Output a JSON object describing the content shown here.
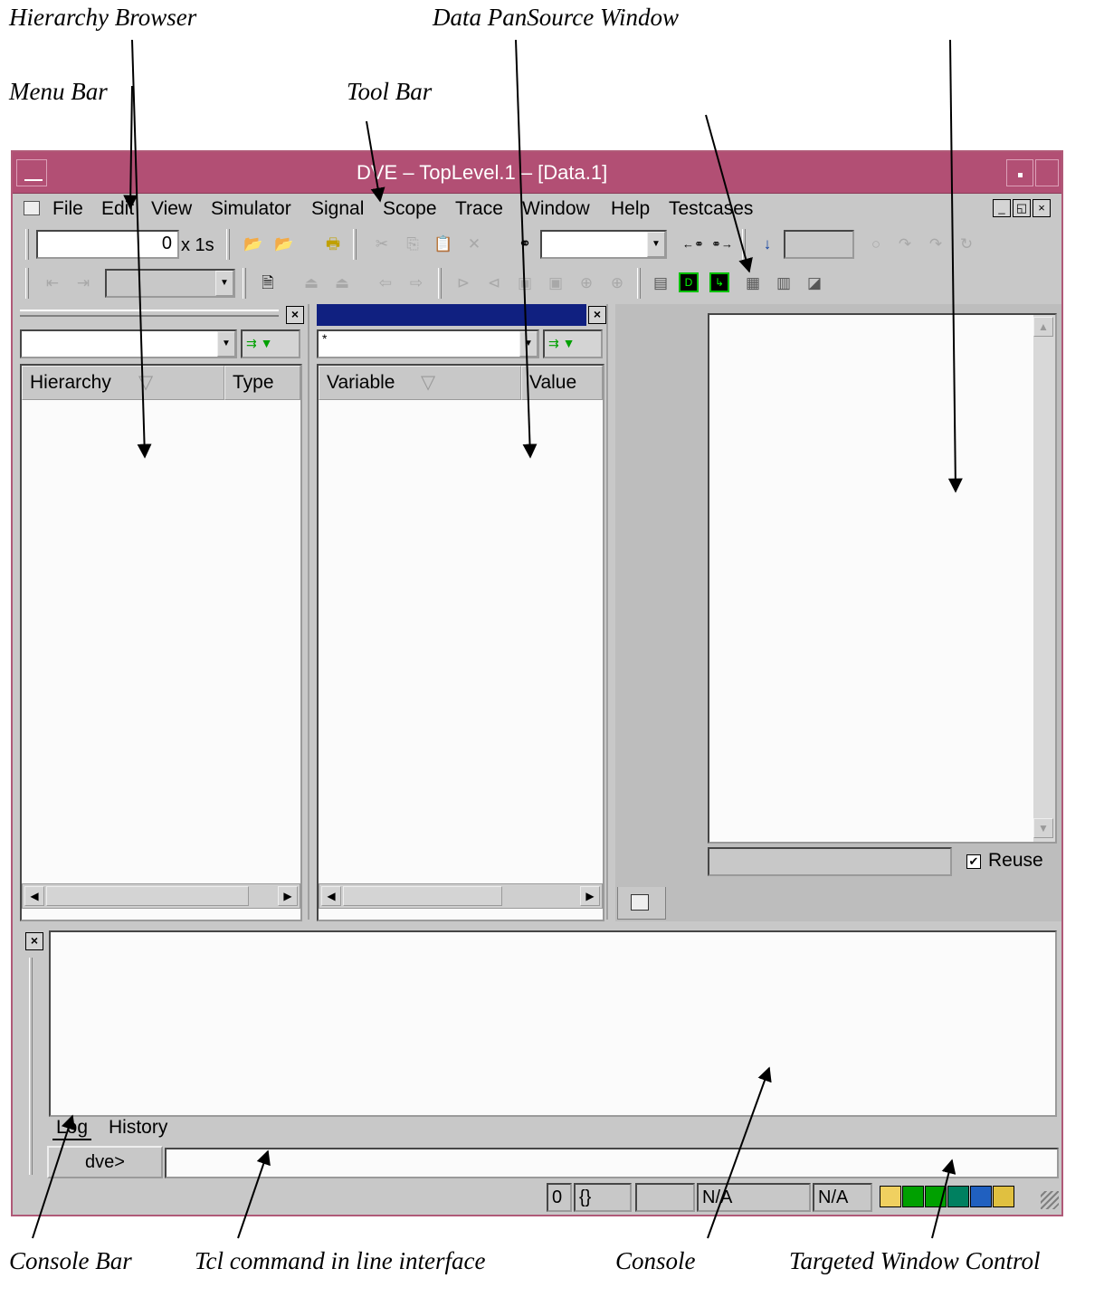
{
  "annotations": {
    "hierarchy_browser": "Hierarchy Browser",
    "data_pane": "Data PanSource Window",
    "menu_bar": "Menu Bar",
    "tool_bar": "Tool Bar",
    "console_bar": "Console Bar",
    "tcl_command": "Tcl command in line interface",
    "console": "Console",
    "targeted_window_control": "Targeted Window Control"
  },
  "window": {
    "title": "DVE – TopLevel.1 – [Data.1]",
    "title_color": "#b24f74"
  },
  "menubar": {
    "items": [
      {
        "label": "File"
      },
      {
        "label": "Edit"
      },
      {
        "label": "View"
      },
      {
        "label": "Simulator"
      },
      {
        "label": "Signal"
      },
      {
        "label": "Scope"
      },
      {
        "label": "Trace"
      },
      {
        "label": "Window"
      },
      {
        "label": "Help"
      },
      {
        "label": "Testcases"
      }
    ]
  },
  "toolbar": {
    "time_value": "0",
    "time_unit": "x 1s"
  },
  "hierarchy_pane": {
    "columns": [
      "Hierarchy",
      "Type"
    ]
  },
  "data_pane": {
    "filter_value": "*",
    "columns": [
      "Variable",
      "Value"
    ]
  },
  "source_window": {
    "reuse_label": "Reuse",
    "reuse_checked": true
  },
  "console": {
    "tabs": [
      "Log",
      "History"
    ],
    "active_tab": "Log",
    "prompt": "dve>"
  },
  "statusbar": {
    "cells": [
      "0",
      "{}",
      "",
      "N/A",
      "N/A"
    ]
  },
  "icons": {
    "open": "folder-open-icon",
    "find": "binoculars-icon",
    "down": "arrow-down-icon"
  }
}
